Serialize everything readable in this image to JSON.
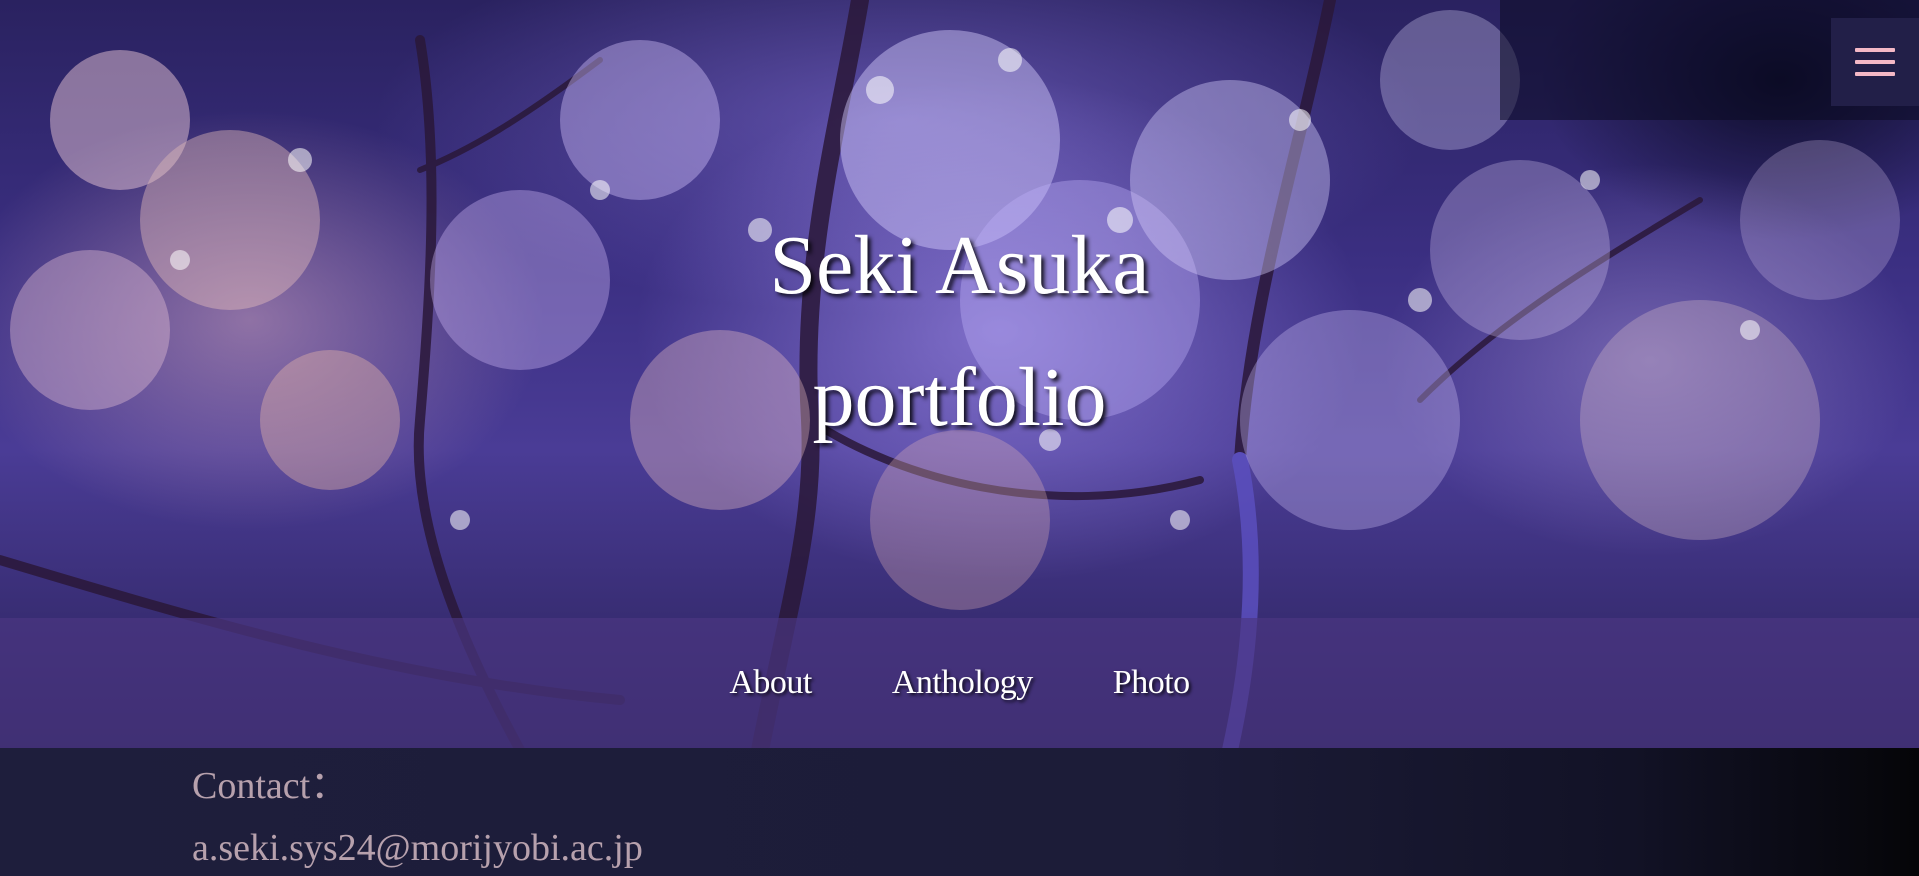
{
  "hero": {
    "title_line1": "Seki Asuka",
    "title_line2": "portfolio"
  },
  "menu": {
    "icon": "hamburger-menu-icon"
  },
  "nav": {
    "items": [
      {
        "label": "About"
      },
      {
        "label": "Anthology"
      },
      {
        "label": "Photo"
      }
    ]
  },
  "contact": {
    "label": "Contact：",
    "email": "a.seki.sys24@morijyobi.ac.jp"
  },
  "colors": {
    "nav_band": "#4b3782",
    "menu_button_bg": "#221f48",
    "menu_icon": "#f4b8c6",
    "contact_text": "#b7a1ad",
    "footer_bg": "#1e1e3c"
  }
}
